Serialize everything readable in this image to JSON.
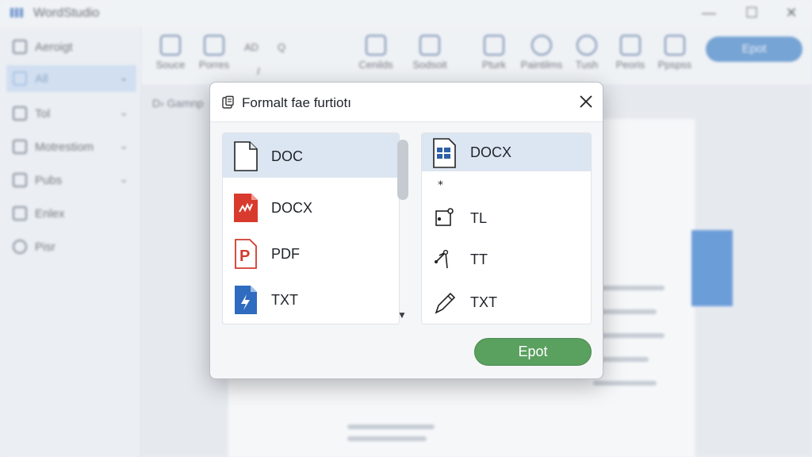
{
  "app": {
    "title": "WordStudio",
    "window_controls": [
      "—",
      "☐",
      "✕"
    ]
  },
  "sidebar": {
    "items": [
      {
        "label": "Aeroigt",
        "icon": "edit-icon",
        "chevron": false,
        "active": false
      },
      {
        "label": "All",
        "icon": "folder-icon",
        "chevron": true,
        "active": true
      },
      {
        "label": "Tol",
        "icon": "document-icon",
        "chevron": true,
        "active": false
      },
      {
        "label": "Motrestiom",
        "icon": "gallery-icon",
        "chevron": true,
        "active": false
      },
      {
        "label": "Pubs",
        "icon": "book-icon",
        "chevron": true,
        "active": false
      },
      {
        "label": "Enlex",
        "icon": "list-icon",
        "chevron": false,
        "active": false
      },
      {
        "label": "Pisr",
        "icon": "reload-icon",
        "chevron": false,
        "active": false
      }
    ]
  },
  "ribbon": {
    "buttons": [
      {
        "label": "Souce",
        "icon": "source-icon"
      },
      {
        "label": "Porres",
        "icon": "properties-icon"
      },
      {
        "label": "Cenilds",
        "icon": "find-icon"
      },
      {
        "label": "Sodsoit",
        "icon": "layout-icon"
      },
      {
        "label": "Pturk",
        "icon": "picture-icon"
      },
      {
        "label": "Paintilms",
        "icon": "paint-icon"
      },
      {
        "label": "Tush",
        "icon": "clock-icon"
      },
      {
        "label": "Peoris",
        "icon": "print-icon"
      },
      {
        "label": "Ppspss",
        "icon": "grid-icon"
      }
    ],
    "small": [
      "AD",
      "Q",
      "I"
    ],
    "export_label": "Epot"
  },
  "document": {
    "breadcrumb": "D› Gamnp"
  },
  "dialog": {
    "title": "Formalt fae furtiotı",
    "left_list": [
      {
        "label": "DOC",
        "icon": "doc-file-icon",
        "selected": true
      },
      {
        "label": "DOCX",
        "icon": "docx-file-icon",
        "selected": false
      },
      {
        "label": "PDF",
        "icon": "pdf-file-icon",
        "selected": false
      },
      {
        "label": "TXT",
        "icon": "txt-file-icon",
        "selected": false
      }
    ],
    "right_list": [
      {
        "label": "DOCX",
        "icon": "table-file-icon",
        "selected": true
      },
      {
        "label": "TL",
        "icon": "node-icon",
        "selected": false
      },
      {
        "label": "TT",
        "icon": "branch-icon",
        "selected": false
      },
      {
        "label": "TXT",
        "icon": "pencil-icon",
        "selected": false
      }
    ],
    "export_button": "Epot"
  }
}
